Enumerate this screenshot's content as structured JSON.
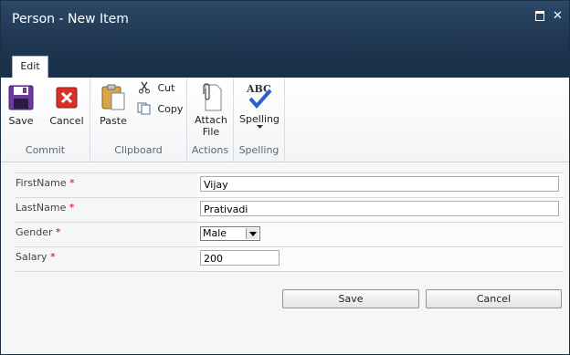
{
  "window": {
    "title": "Person - New Item",
    "maximize_icon": "maximize-icon",
    "close_glyph": "✕"
  },
  "tabs": [
    {
      "label": "Edit"
    }
  ],
  "ribbon": {
    "commit": {
      "label": "Commit",
      "save": "Save",
      "cancel": "Cancel"
    },
    "clipboard": {
      "label": "Clipboard",
      "paste": "Paste",
      "cut": "Cut",
      "copy": "Copy"
    },
    "actions": {
      "label": "Actions",
      "attach_line1": "Attach",
      "attach_line2": "File"
    },
    "spelling": {
      "label": "Spelling",
      "spelling": "Spelling",
      "abc": "ABC"
    }
  },
  "form": {
    "required_marker": "*",
    "fields": [
      {
        "label": "FirstName",
        "value": "Vijay"
      },
      {
        "label": "LastName",
        "value": "Prativadi"
      },
      {
        "label": "Gender",
        "value": "Male"
      },
      {
        "label": "Salary",
        "value": "200"
      }
    ]
  },
  "buttons": {
    "save": "Save",
    "cancel": "Cancel"
  }
}
